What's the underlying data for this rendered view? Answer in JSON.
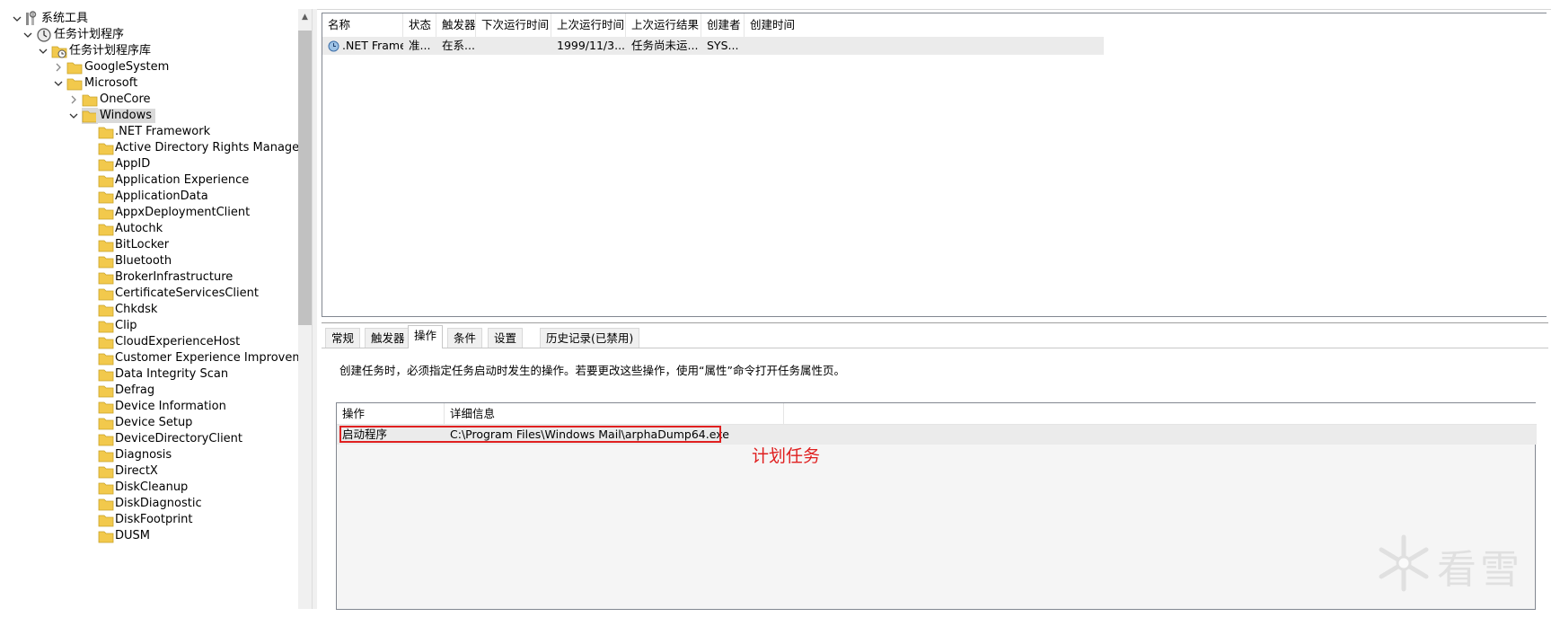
{
  "tree": {
    "root": "系统工具",
    "task_scheduler": "任务计划程序",
    "library": "任务计划程序库",
    "google_system": "GoogleSystem",
    "microsoft": "Microsoft",
    "onecore": "OneCore",
    "windows": "Windows",
    "windows_children": [
      ".NET Framework",
      "Active Directory Rights Managem",
      "AppID",
      "Application Experience",
      "ApplicationData",
      "AppxDeploymentClient",
      "Autochk",
      "BitLocker",
      "Bluetooth",
      "BrokerInfrastructure",
      "CertificateServicesClient",
      "Chkdsk",
      "Clip",
      "CloudExperienceHost",
      "Customer Experience Improveme",
      "Data Integrity Scan",
      "Defrag",
      "Device Information",
      "Device Setup",
      "DeviceDirectoryClient",
      "Diagnosis",
      "DirectX",
      "DiskCleanup",
      "DiskDiagnostic",
      "DiskFootprint",
      "DUSM"
    ]
  },
  "task_list": {
    "columns": [
      "名称",
      "状态",
      "触发器",
      "下次运行时间",
      "上次运行时间",
      "上次运行结果",
      "创建者",
      "创建时间"
    ],
    "rows": [
      {
        "name": ".NET Frame...",
        "status": "准...",
        "trigger": "在系...",
        "next_run": "",
        "last_run": "1999/11/3...",
        "last_result": "任务尚未运...",
        "author": "SYS...",
        "created": ""
      }
    ]
  },
  "tabs": [
    "常规",
    "触发器",
    "操作",
    "条件",
    "设置",
    "历史记录(已禁用)"
  ],
  "active_tab": "操作",
  "actions_pane": {
    "info_text": "创建任务时，必须指定任务启动时发生的操作。若要更改这些操作，使用“属性”命令打开任务属性页。",
    "columns": [
      "操作",
      "详细信息"
    ],
    "rows": [
      {
        "action": "启动程序",
        "details": "C:\\Program Files\\Windows Mail\\arphaDump64.exe"
      }
    ],
    "annotation": "计划任务"
  },
  "watermark": "看雪",
  "colors": {
    "annotation_red": "#e02020",
    "folder_yellow": "#f2c94c",
    "selected_row": "#d9d9d9"
  }
}
